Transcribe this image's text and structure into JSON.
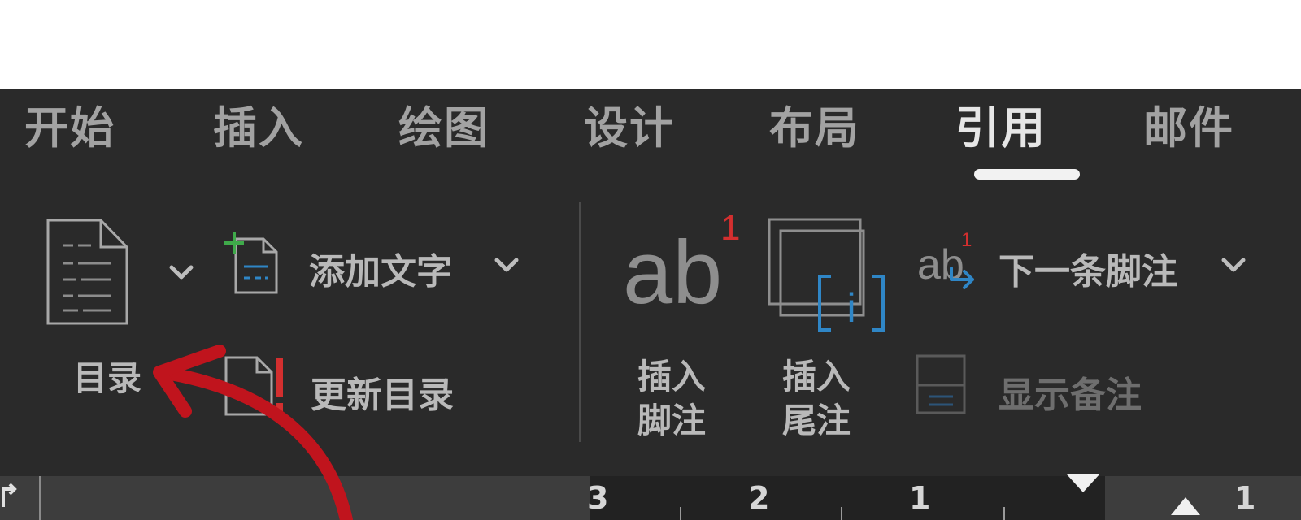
{
  "tabs": [
    {
      "label": "开始",
      "active": false
    },
    {
      "label": "插入",
      "active": false
    },
    {
      "label": "绘图",
      "active": false
    },
    {
      "label": "设计",
      "active": false
    },
    {
      "label": "布局",
      "active": false
    },
    {
      "label": "引用",
      "active": true
    },
    {
      "label": "邮件",
      "active": false
    }
  ],
  "toc_group": {
    "toc_label": "目录",
    "add_text_label": "添加文字",
    "update_toc_label": "更新目录"
  },
  "footnotes_group": {
    "insert_footnote_line1": "插入",
    "insert_footnote_line2": "脚注",
    "insert_endnote_line1": "插入",
    "insert_endnote_line2": "尾注",
    "next_footnote_label": "下一条脚注",
    "show_notes_label": "显示备注",
    "footnote_icon_text": "ab",
    "footnote_superscript": "1",
    "endnote_icon_text": "i"
  },
  "ruler": {
    "numbers": [
      "3",
      "2",
      "1",
      "1"
    ]
  },
  "colors": {
    "ribbon_bg": "#2a2a2a",
    "tab_text": "#a2a2a2",
    "annotation_arrow": "#c0141d",
    "accent_blue": "#2f86c6",
    "accent_red": "#d32f2f",
    "accent_green": "#3faa4a"
  },
  "icons": {
    "toc": "document-lines-icon",
    "add_text": "add-text-icon",
    "update_toc": "update-document-icon",
    "insert_footnote": "footnote-ab-icon",
    "insert_endnote": "endnote-icon",
    "next_footnote": "next-footnote-icon",
    "show_notes": "show-notes-icon",
    "annotation": "red-curved-arrow-icon"
  }
}
